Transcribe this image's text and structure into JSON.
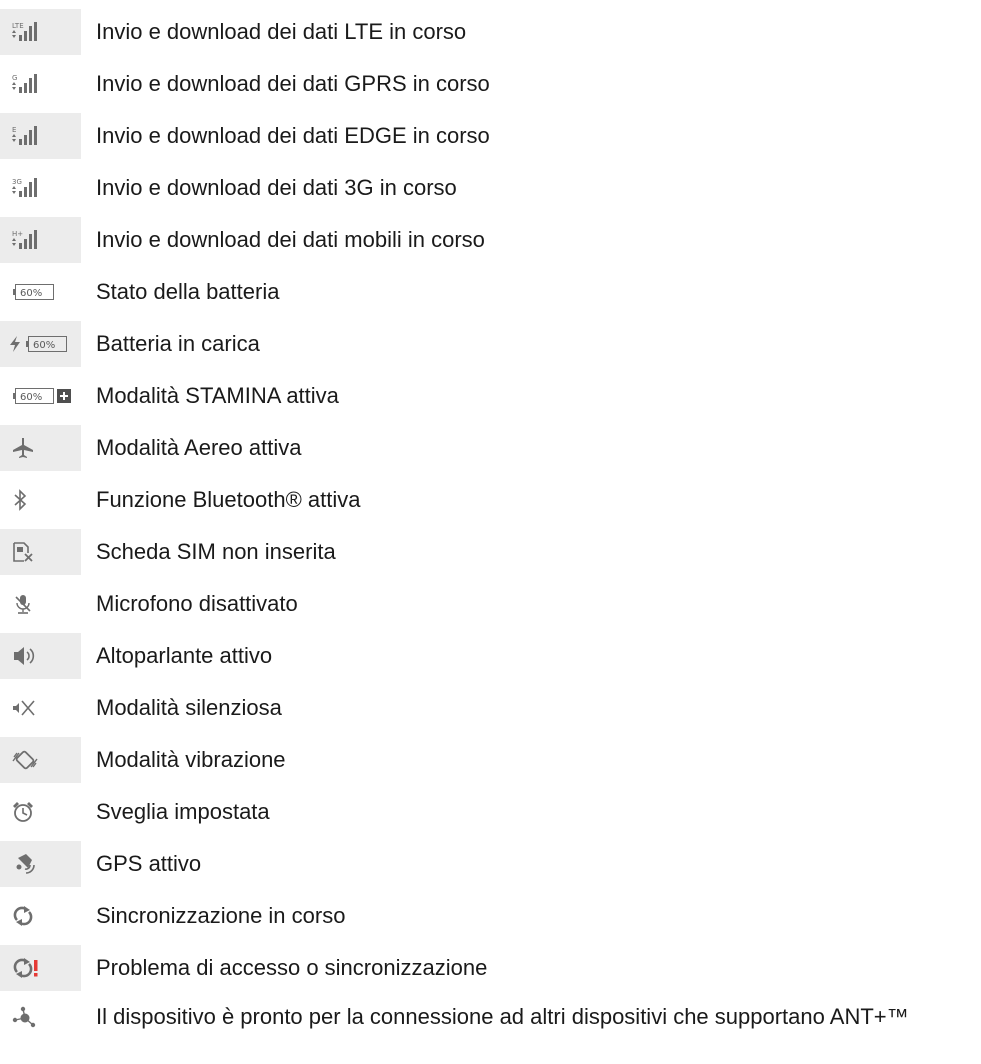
{
  "rows": [
    {
      "icon": "lte-data-icon",
      "badge": "LTE",
      "label": "Invio e download dei dati LTE in corso"
    },
    {
      "icon": "gprs-data-icon",
      "badge": "G",
      "label": "Invio e download dei dati GPRS in corso"
    },
    {
      "icon": "edge-data-icon",
      "badge": "E",
      "label": "Invio e download dei dati EDGE in corso"
    },
    {
      "icon": "3g-data-icon",
      "badge": "3G",
      "label": "Invio e download dei dati 3G in corso"
    },
    {
      "icon": "hplus-data-icon",
      "badge": "H+",
      "label": "Invio e download dei dati mobili in corso"
    },
    {
      "icon": "battery-icon",
      "badge": "60%",
      "label": "Stato della batteria"
    },
    {
      "icon": "battery-charging-icon",
      "badge": "60%",
      "label": "Batteria in carica"
    },
    {
      "icon": "battery-stamina-icon",
      "badge": "60%",
      "label": "Modalità STAMINA attiva"
    },
    {
      "icon": "airplane-icon",
      "label": "Modalità Aereo attiva"
    },
    {
      "icon": "bluetooth-icon",
      "label": "Funzione Bluetooth® attiva"
    },
    {
      "icon": "no-sim-icon",
      "label": "Scheda SIM non inserita"
    },
    {
      "icon": "mic-muted-icon",
      "label": "Microfono disattivato"
    },
    {
      "icon": "speaker-icon",
      "label": "Altoparlante attivo"
    },
    {
      "icon": "silent-mode-icon",
      "label": "Modalità silenziosa"
    },
    {
      "icon": "vibrate-icon",
      "label": "Modalità vibrazione"
    },
    {
      "icon": "alarm-icon",
      "label": "Sveglia impostata"
    },
    {
      "icon": "gps-icon",
      "label": "GPS attivo"
    },
    {
      "icon": "sync-icon",
      "label": "Sincronizzazione in corso"
    },
    {
      "icon": "sync-problem-icon",
      "label": "Problema di accesso o sincronizzazione"
    },
    {
      "icon": "ant-plus-icon",
      "label": "Il dispositivo è pronto per la connessione ad altri dispositivi che supportano ANT+™"
    }
  ],
  "colors": {
    "shade": "#ececec",
    "icon": "#6e6e6e",
    "alert": "#e53935"
  }
}
